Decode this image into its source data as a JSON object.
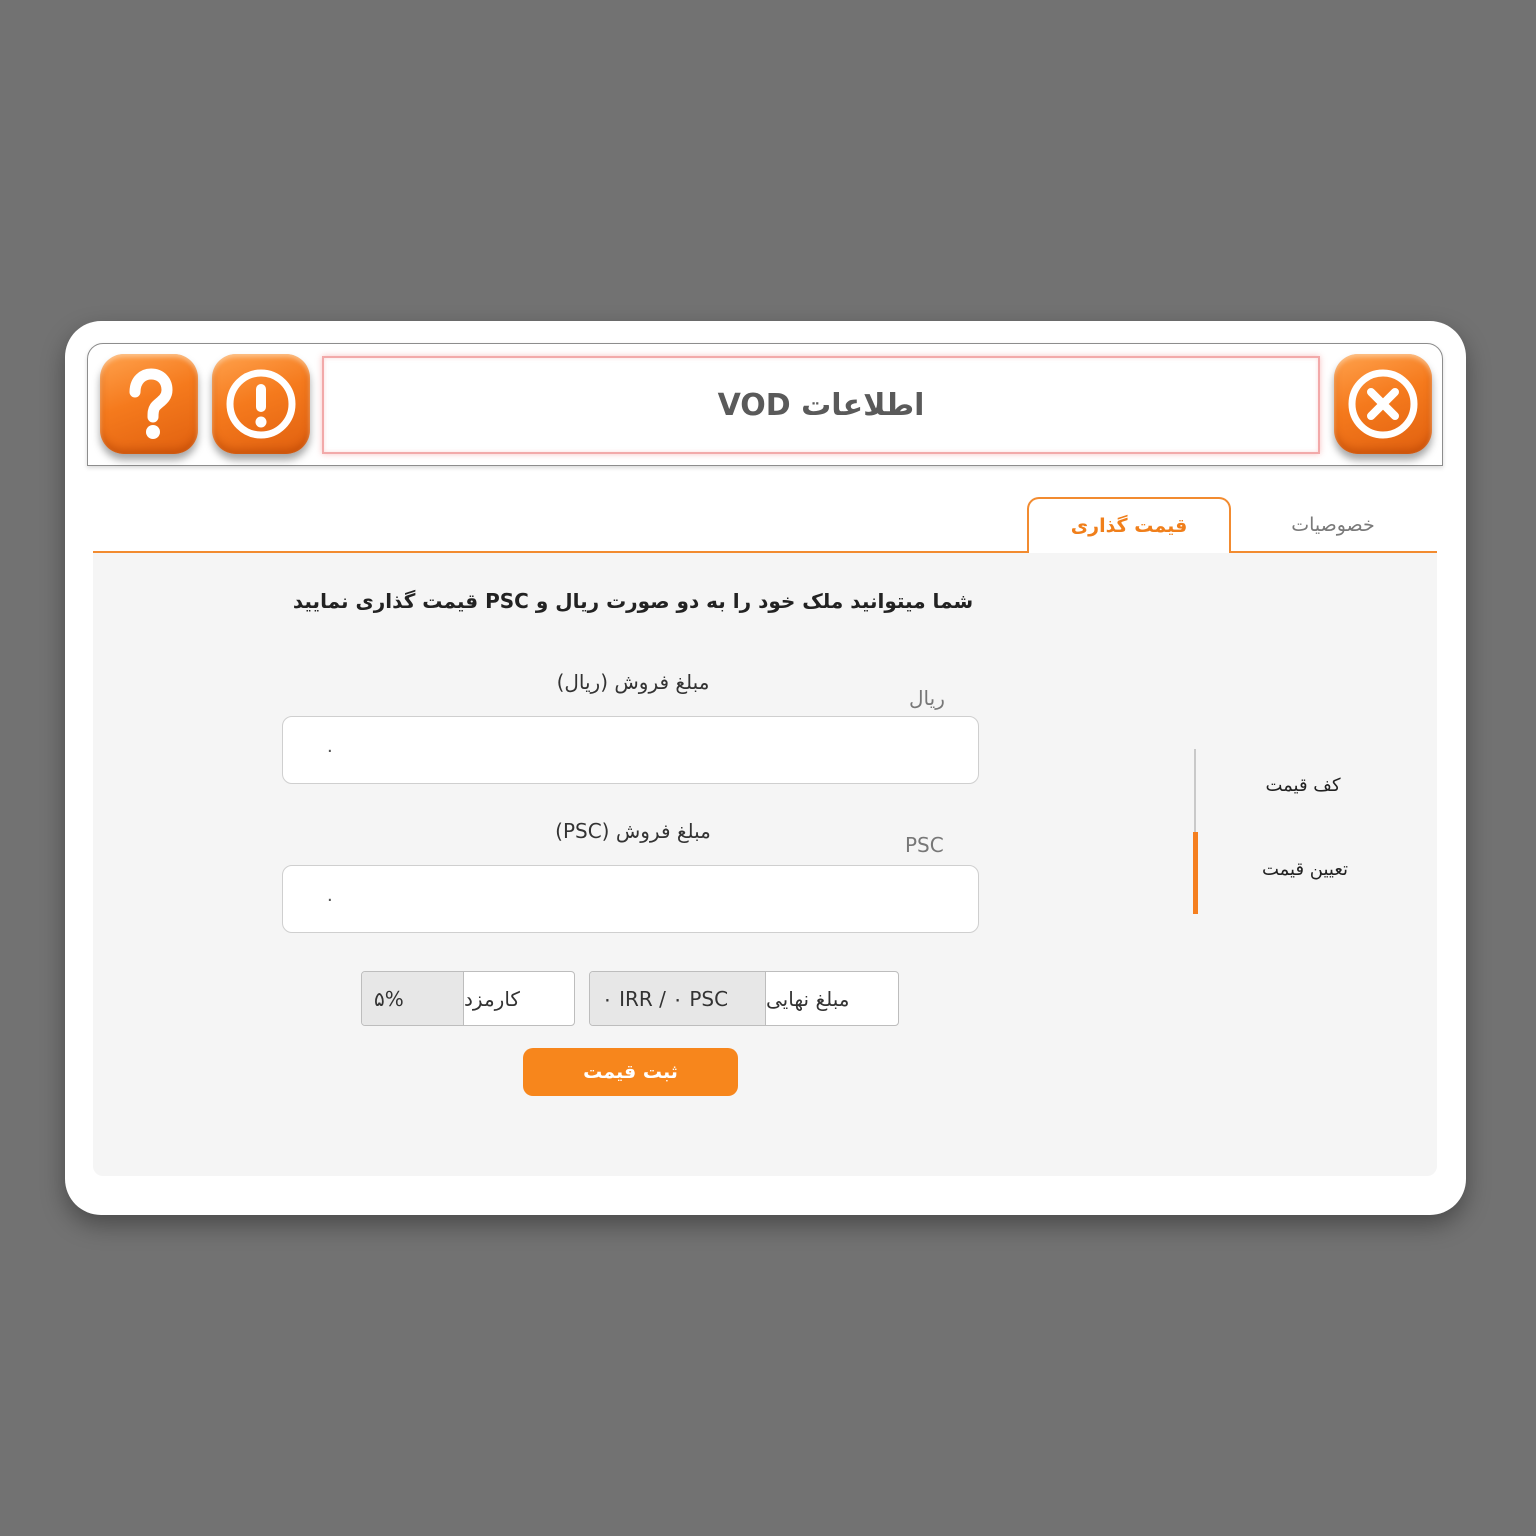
{
  "window": {
    "title": "اطلاعات VOD"
  },
  "tabs": [
    {
      "label": "قیمت گذاری",
      "active": true
    },
    {
      "label": "خصوصیات",
      "active": false
    }
  ],
  "pricing": {
    "intro": "شما میتوانید ملک خود را به دو صورت ریال و PSC قیمت گذاری نمایید",
    "rial": {
      "label": "مبلغ فروش (ریال)",
      "unit": "ریال",
      "value": "۰"
    },
    "psc": {
      "label": "مبلغ فروش (PSC)",
      "unit": "PSC",
      "value": "۰"
    },
    "commission": {
      "label": "کارمزد",
      "value": "۵%"
    },
    "final": {
      "label": "مبلغ نهایی",
      "value": "۰ IRR / ۰ PSC"
    },
    "submit_label": "ثبت قیمت"
  },
  "sidenav": [
    {
      "label": "کف قیمت",
      "active": false
    },
    {
      "label": "تعیین قیمت",
      "active": true
    }
  ],
  "icons": {
    "help": "question-icon",
    "info": "exclamation-icon",
    "close": "close-icon"
  },
  "colors": {
    "accent": "#f7861c",
    "background": "#727272"
  }
}
